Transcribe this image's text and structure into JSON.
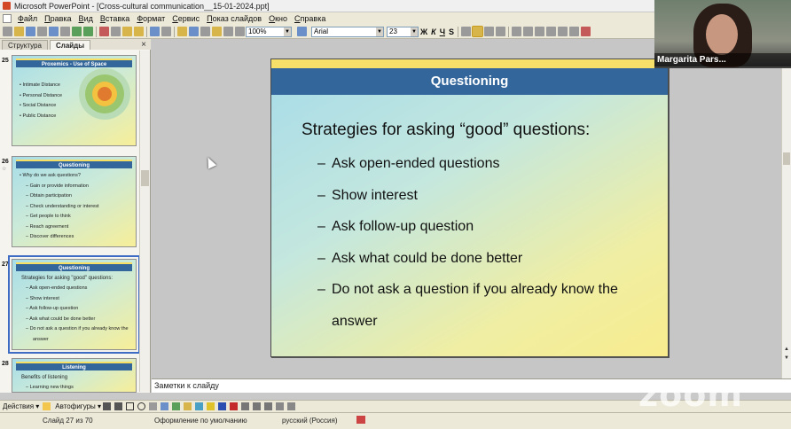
{
  "window": {
    "title": "Microsoft PowerPoint - [Cross-cultural communication__15-01-2024.ppt]"
  },
  "menu": [
    "Файл",
    "Правка",
    "Вид",
    "Вставка",
    "Формат",
    "Сервис",
    "Показ слайдов",
    "Окно",
    "Справка"
  ],
  "toolbar": {
    "zoom": "100%",
    "font": "Arial",
    "size": "23",
    "bold": "Ж",
    "italic": "К",
    "underline": "Ч",
    "shadow": "S"
  },
  "panel": {
    "tabs": [
      "Структура",
      "Слайды"
    ],
    "close": "×",
    "thumbs": [
      {
        "num": "25",
        "title": "Proxemics - Use of Space",
        "bullets": [
          "• Intimate Distance",
          "• Personal Distance",
          "• Social Distance",
          "• Public Distance"
        ]
      },
      {
        "num": "26",
        "sub": "☆",
        "title": "Questioning",
        "bullets": [
          "• Why do we ask questions?"
        ],
        "subbullets": [
          "– Gain or provide information",
          "– Obtain participation",
          "– Check understanding or interest",
          "– Get people to think",
          "– Reach agreement",
          "– Discover differences"
        ]
      },
      {
        "num": "27",
        "title": "Questioning",
        "head": "Strategies for asking \"good\" questions:",
        "subbullets": [
          "– Ask open-ended questions",
          "– Show interest",
          "– Ask follow-up question",
          "– Ask what could be done better",
          "– Do not ask a question if you already know the",
          "answer"
        ]
      },
      {
        "num": "28",
        "title": "Listening",
        "head": "Benefits of listening",
        "subbullets": [
          "– Learning new things"
        ]
      }
    ]
  },
  "slide": {
    "title": "Questioning",
    "heading": "Strategies for asking “good” questions:",
    "bullets": [
      "Ask open-ended questions",
      "Show interest",
      "Ask follow-up question",
      "Ask what could be done better",
      "Do not ask a question if you already know the"
    ],
    "continuation": "answer",
    "dash": "–"
  },
  "notes": {
    "text": "Заметки к слайду"
  },
  "drawbar": {
    "actions": "Действия ▾",
    "autoshapes": "Автофигуры ▾"
  },
  "status": {
    "slide": "Слайд 27 из 70",
    "design": "Оформление по умолчанию",
    "language": "русский (Россия)"
  },
  "webcam": {
    "name": "Margarita Pars..."
  },
  "zoom_logo": "zoom"
}
